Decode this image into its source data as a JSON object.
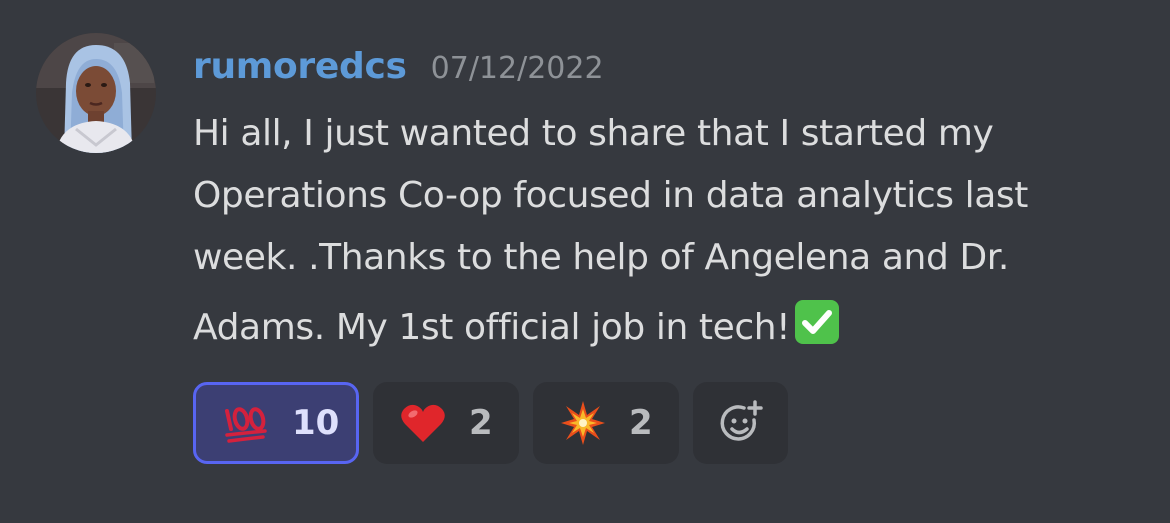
{
  "message": {
    "author": "rumoredcs",
    "timestamp": "07/12/2022",
    "lines": [
      "Hi all, I just wanted to share that I started my",
      "Operations Co-op focused in data analytics last",
      "week. .Thanks to the help of Angelena and Dr.",
      "Adams. My 1st official job in tech!"
    ],
    "trailing_emoji": "white-check-mark-icon"
  },
  "reactions": [
    {
      "emoji": "hundred-points-icon",
      "count": "10",
      "active": true
    },
    {
      "emoji": "red-heart-icon",
      "count": "2",
      "active": false
    },
    {
      "emoji": "collision-icon",
      "count": "2",
      "active": false
    }
  ],
  "add_reaction": {
    "icon": "add-reaction-icon"
  },
  "colors": {
    "background": "#36393f",
    "username": "#5d9ad8",
    "timestamp": "#8e9297",
    "text": "#dcddde",
    "reaction_bg": "#2f3136",
    "reaction_active_bg": "#3c3f73",
    "reaction_active_border": "#5865f2"
  }
}
